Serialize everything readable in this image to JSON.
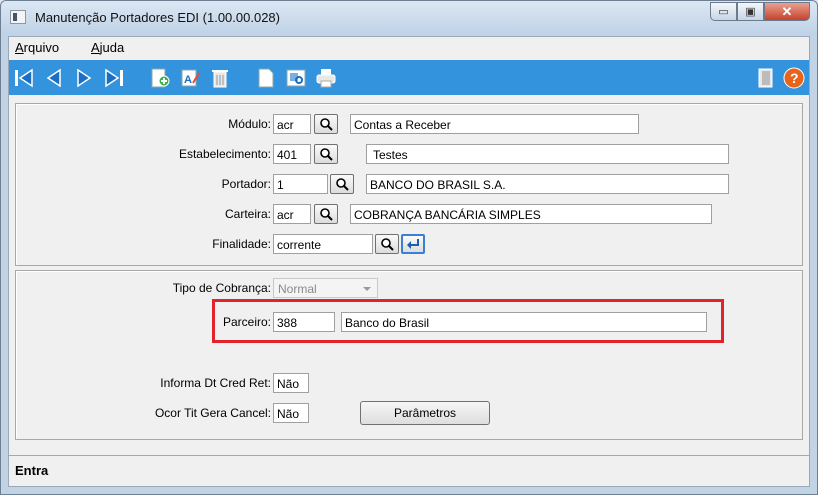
{
  "window": {
    "title": "Manutenção Portadores EDI (1.00.00.028)",
    "minimize_glyph": "▭",
    "maximize_glyph": "▣",
    "close_glyph": "✕"
  },
  "menu": [
    {
      "label": "Arquivo",
      "accel": "A"
    },
    {
      "label": "Ajuda",
      "accel": "A"
    }
  ],
  "toolbar": {
    "icons": [
      "first-record-icon",
      "previous-record-icon",
      "next-record-icon",
      "last-record-icon",
      "add-record-icon",
      "edit-record-icon",
      "delete-record-icon",
      "new-document-icon",
      "preview-icon",
      "print-icon",
      "exit-door-icon",
      "help-icon"
    ],
    "accent": "#3393dd"
  },
  "form": {
    "modulo": {
      "label": "Módulo:",
      "code": "acr",
      "description": "Contas a Receber"
    },
    "estabelecimento": {
      "label": "Estabelecimento:",
      "code": "401",
      "description": "Testes"
    },
    "portador": {
      "label": "Portador:",
      "code": "1",
      "description": "BANCO DO BRASIL S.A."
    },
    "carteira": {
      "label": "Carteira:",
      "code": "acr",
      "description": "COBRANÇA BANCÁRIA SIMPLES"
    },
    "finalidade": {
      "label": "Finalidade:",
      "value": "corrente"
    },
    "tipo_cobranca": {
      "label": "Tipo de Cobrança:",
      "value": "Normal"
    },
    "parceiro": {
      "label": "Parceiro:",
      "code": "388",
      "description": "Banco do Brasil"
    },
    "informa_dt_cred_ret": {
      "label": "Informa Dt Cred Ret:",
      "value": "Não"
    },
    "ocor_tit_gera_cancel": {
      "label": "Ocor Tit Gera Cancel:",
      "value": "Não"
    },
    "parametros_button": "Parâmetros"
  },
  "highlight_color": "#e0242a",
  "status": {
    "text": "Entra"
  }
}
